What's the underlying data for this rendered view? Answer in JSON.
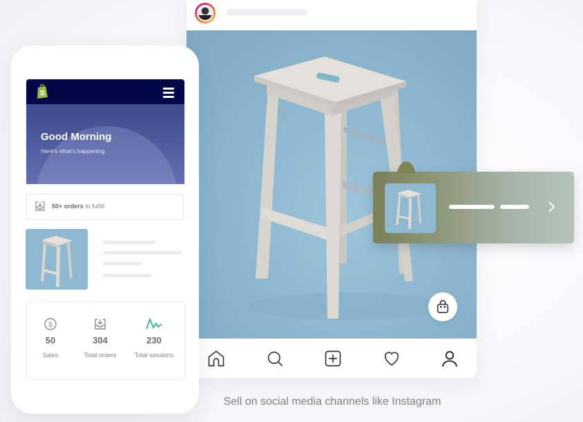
{
  "phone_app": {
    "brand": "shopify",
    "greeting_title": "Good Morning",
    "greeting_subtitle": "Here's what's happening.",
    "orders_alert": {
      "count_label": "50+ orders",
      "suffix": " to fulfill"
    },
    "stats": [
      {
        "icon": "dollar-circle-icon",
        "value": "50",
        "label": "Sales"
      },
      {
        "icon": "inbox-download-icon",
        "value": "304",
        "label": "Total orders"
      },
      {
        "icon": "sessions-sparkline-icon",
        "value": "230",
        "label": "Total sessions"
      }
    ],
    "colors": {
      "header": "#020748",
      "hero": "#4e5b9d",
      "accent_teal": "#3fb6a8",
      "logo_green": "#95bf47"
    }
  },
  "instagram_post": {
    "nav_items": [
      {
        "name": "home",
        "icon": "home-icon"
      },
      {
        "name": "search",
        "icon": "search-icon"
      },
      {
        "name": "create",
        "icon": "plus-square-icon"
      },
      {
        "name": "activity",
        "icon": "heart-icon"
      },
      {
        "name": "profile",
        "icon": "user-icon"
      }
    ],
    "shopping_bag_icon": "shopping-bag-icon",
    "product_tag_arrow": "chevron-right-icon"
  },
  "caption": "Sell on social media channels like Instagram"
}
